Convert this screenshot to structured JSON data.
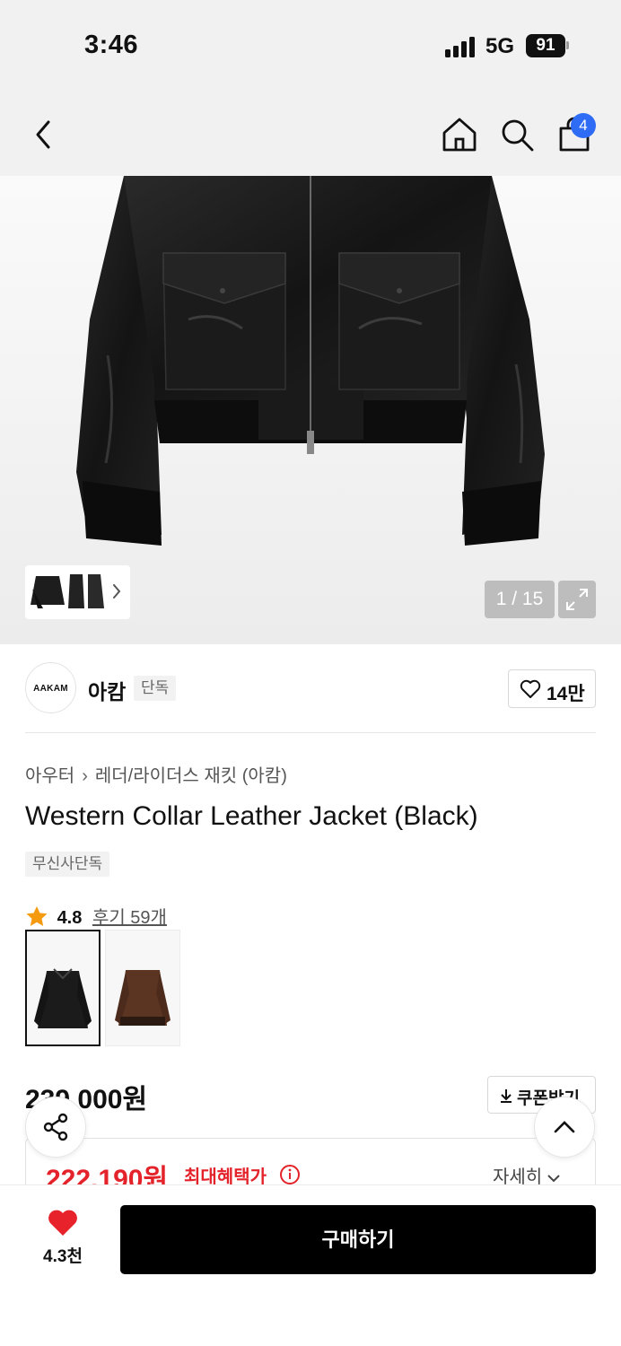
{
  "status_bar": {
    "time": "3:46",
    "network": "5G",
    "battery": "91"
  },
  "header": {
    "cart_count": "4",
    "icons": [
      "back-icon",
      "home-icon",
      "search-icon",
      "bag-icon"
    ]
  },
  "gallery": {
    "counter": "1 / 15"
  },
  "brand": {
    "logo_text": "AAKAM",
    "name": "아캄",
    "tag": "단독",
    "likes": "14만"
  },
  "product": {
    "breadcrumb": [
      "아우터",
      "레더/라이더스 재킷 (아캄)"
    ],
    "title": "Western Collar Leather Jacket (Black)",
    "exclusive_badge": "무신사단독",
    "rating": "4.8",
    "reviews_label": "후기 59개",
    "colors": [
      "black",
      "brown"
    ]
  },
  "pricing": {
    "price": "239,000원",
    "coupon_label": "쿠폰받기",
    "sale_price": "222,190원",
    "max_benefit_label": "최대혜택가",
    "detail_label": "자세히"
  },
  "bottom_bar": {
    "wish_count": "4.3천",
    "buy_label": "구매하기"
  },
  "colors": {
    "badge_blue": "#2f6cf6",
    "sale_red": "#e3222a",
    "heart_red": "#e8222b"
  }
}
